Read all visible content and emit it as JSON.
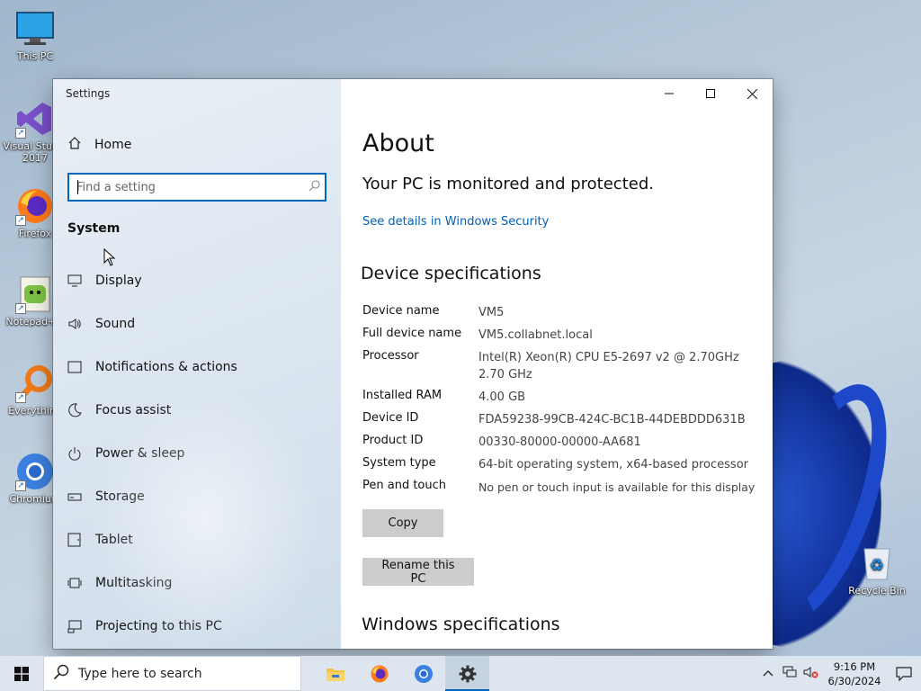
{
  "desktop": {
    "icons": [
      {
        "label": "This PC"
      },
      {
        "label": "Visual Studio 2017"
      },
      {
        "label": "Firefox"
      },
      {
        "label": "Notepad++"
      },
      {
        "label": "Everything"
      },
      {
        "label": "Chromium"
      },
      {
        "label": "Recycle Bin"
      }
    ]
  },
  "window": {
    "title": "Settings",
    "minimize": "—",
    "maximize": "☐",
    "close": "✕"
  },
  "sidebar": {
    "home_label": "Home",
    "search_placeholder": "Find a setting",
    "section": "System",
    "items": [
      {
        "label": "Display",
        "icon": "display-icon"
      },
      {
        "label": "Sound",
        "icon": "sound-icon"
      },
      {
        "label": "Notifications & actions",
        "icon": "notifications-icon"
      },
      {
        "label": "Focus assist",
        "icon": "moon-icon"
      },
      {
        "label": "Power & sleep",
        "icon": "power-icon"
      },
      {
        "label": "Storage",
        "icon": "storage-icon"
      },
      {
        "label": "Tablet",
        "icon": "tablet-icon"
      },
      {
        "label": "Multitasking",
        "icon": "multitasking-icon"
      },
      {
        "label": "Projecting to this PC",
        "icon": "projecting-icon"
      }
    ]
  },
  "about": {
    "title": "About",
    "protected": "Your PC is monitored and protected.",
    "security_link": "See details in Windows Security",
    "device_heading": "Device specifications",
    "specs": [
      {
        "key": "Device name",
        "value": "VM5"
      },
      {
        "key": "Full device name",
        "value": "VM5.collabnet.local"
      },
      {
        "key": "Processor",
        "value": "Intel(R) Xeon(R) CPU E5-2697 v2 @ 2.70GHz 2.70 GHz"
      },
      {
        "key": "Installed RAM",
        "value": "4.00 GB"
      },
      {
        "key": "Device ID",
        "value": "FDA59238-99CB-424C-BC1B-44DEBDDD631B"
      },
      {
        "key": "Product ID",
        "value": "00330-80000-00000-AA681"
      },
      {
        "key": "System type",
        "value": "64-bit operating system, x64-based processor"
      },
      {
        "key": "Pen and touch",
        "value": "No pen or touch input is available for this display"
      }
    ],
    "copy_button": "Copy",
    "rename_button": "Rename this PC",
    "windows_heading": "Windows specifications"
  },
  "taskbar": {
    "search_placeholder": "Type here to search",
    "time": "9:16 PM",
    "date": "6/30/2024"
  },
  "colors": {
    "accent": "#0067c0",
    "link": "#0060b8",
    "button": "#cccccc"
  }
}
